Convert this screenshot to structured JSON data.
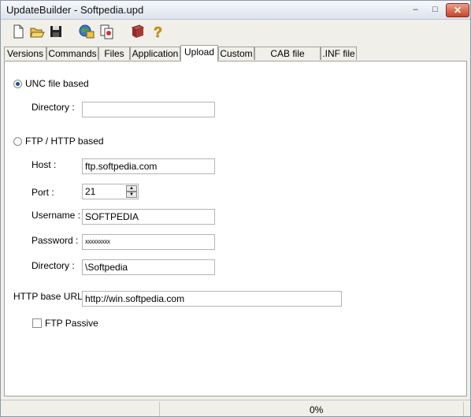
{
  "window": {
    "title": "UpdateBuilder - Softpedia.upd",
    "minimize": "–",
    "maximize": "□",
    "close": "✕"
  },
  "toolbar": {
    "icons": [
      "new-file-icon",
      "open-folder-icon",
      "save-icon",
      "globe-build-icon",
      "reports-icon",
      "book-icon",
      "help-icon"
    ]
  },
  "tabs": [
    {
      "label": "Versions"
    },
    {
      "label": "Commands"
    },
    {
      "label": "Files"
    },
    {
      "label": "Application"
    },
    {
      "label": "Upload"
    },
    {
      "label": "Custom"
    },
    {
      "label": "CAB file creator"
    },
    {
      "label": ".INF file"
    }
  ],
  "active_tab": "Upload",
  "upload": {
    "unc_label": "UNC file based",
    "unc_selected": true,
    "unc_directory_label": "Directory :",
    "unc_directory_value": "",
    "ftp_label": "FTP / HTTP based",
    "host_label": "Host :",
    "host_value": "ftp.softpedia.com",
    "port_label": "Port :",
    "port_value": "21",
    "username_label": "Username :",
    "username_value": "SOFTPEDIA",
    "password_label": "Password :",
    "password_value": "xxxxxxxxx",
    "ftp_directory_label": "Directory :",
    "ftp_directory_value": "\\Softpedia",
    "http_base_label": "HTTP base URL :",
    "http_base_value": "http://win.softpedia.com",
    "ftp_passive_label": "FTP Passive",
    "ftp_passive_checked": false
  },
  "status": {
    "progress_text": "0%"
  }
}
